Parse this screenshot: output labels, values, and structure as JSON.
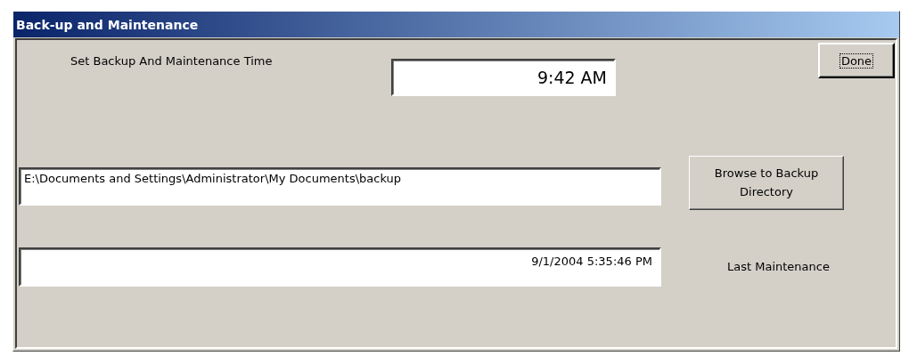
{
  "window": {
    "title": "Back-up and Maintenance"
  },
  "time_label": "Set Backup And Maintenance Time",
  "time_field": {
    "value": "9:42 AM"
  },
  "done_button": {
    "label": "Done",
    "focused": true
  },
  "directory_field": {
    "value": "E:\\Documents and Settings\\Administrator\\My Documents\\backup"
  },
  "browse_button": {
    "label": "Browse to Backup Directory"
  },
  "last_maintenance_field": {
    "value": "9/1/2004 5:35:46 PM"
  },
  "last_maintenance_label": "Last Maintenance"
}
